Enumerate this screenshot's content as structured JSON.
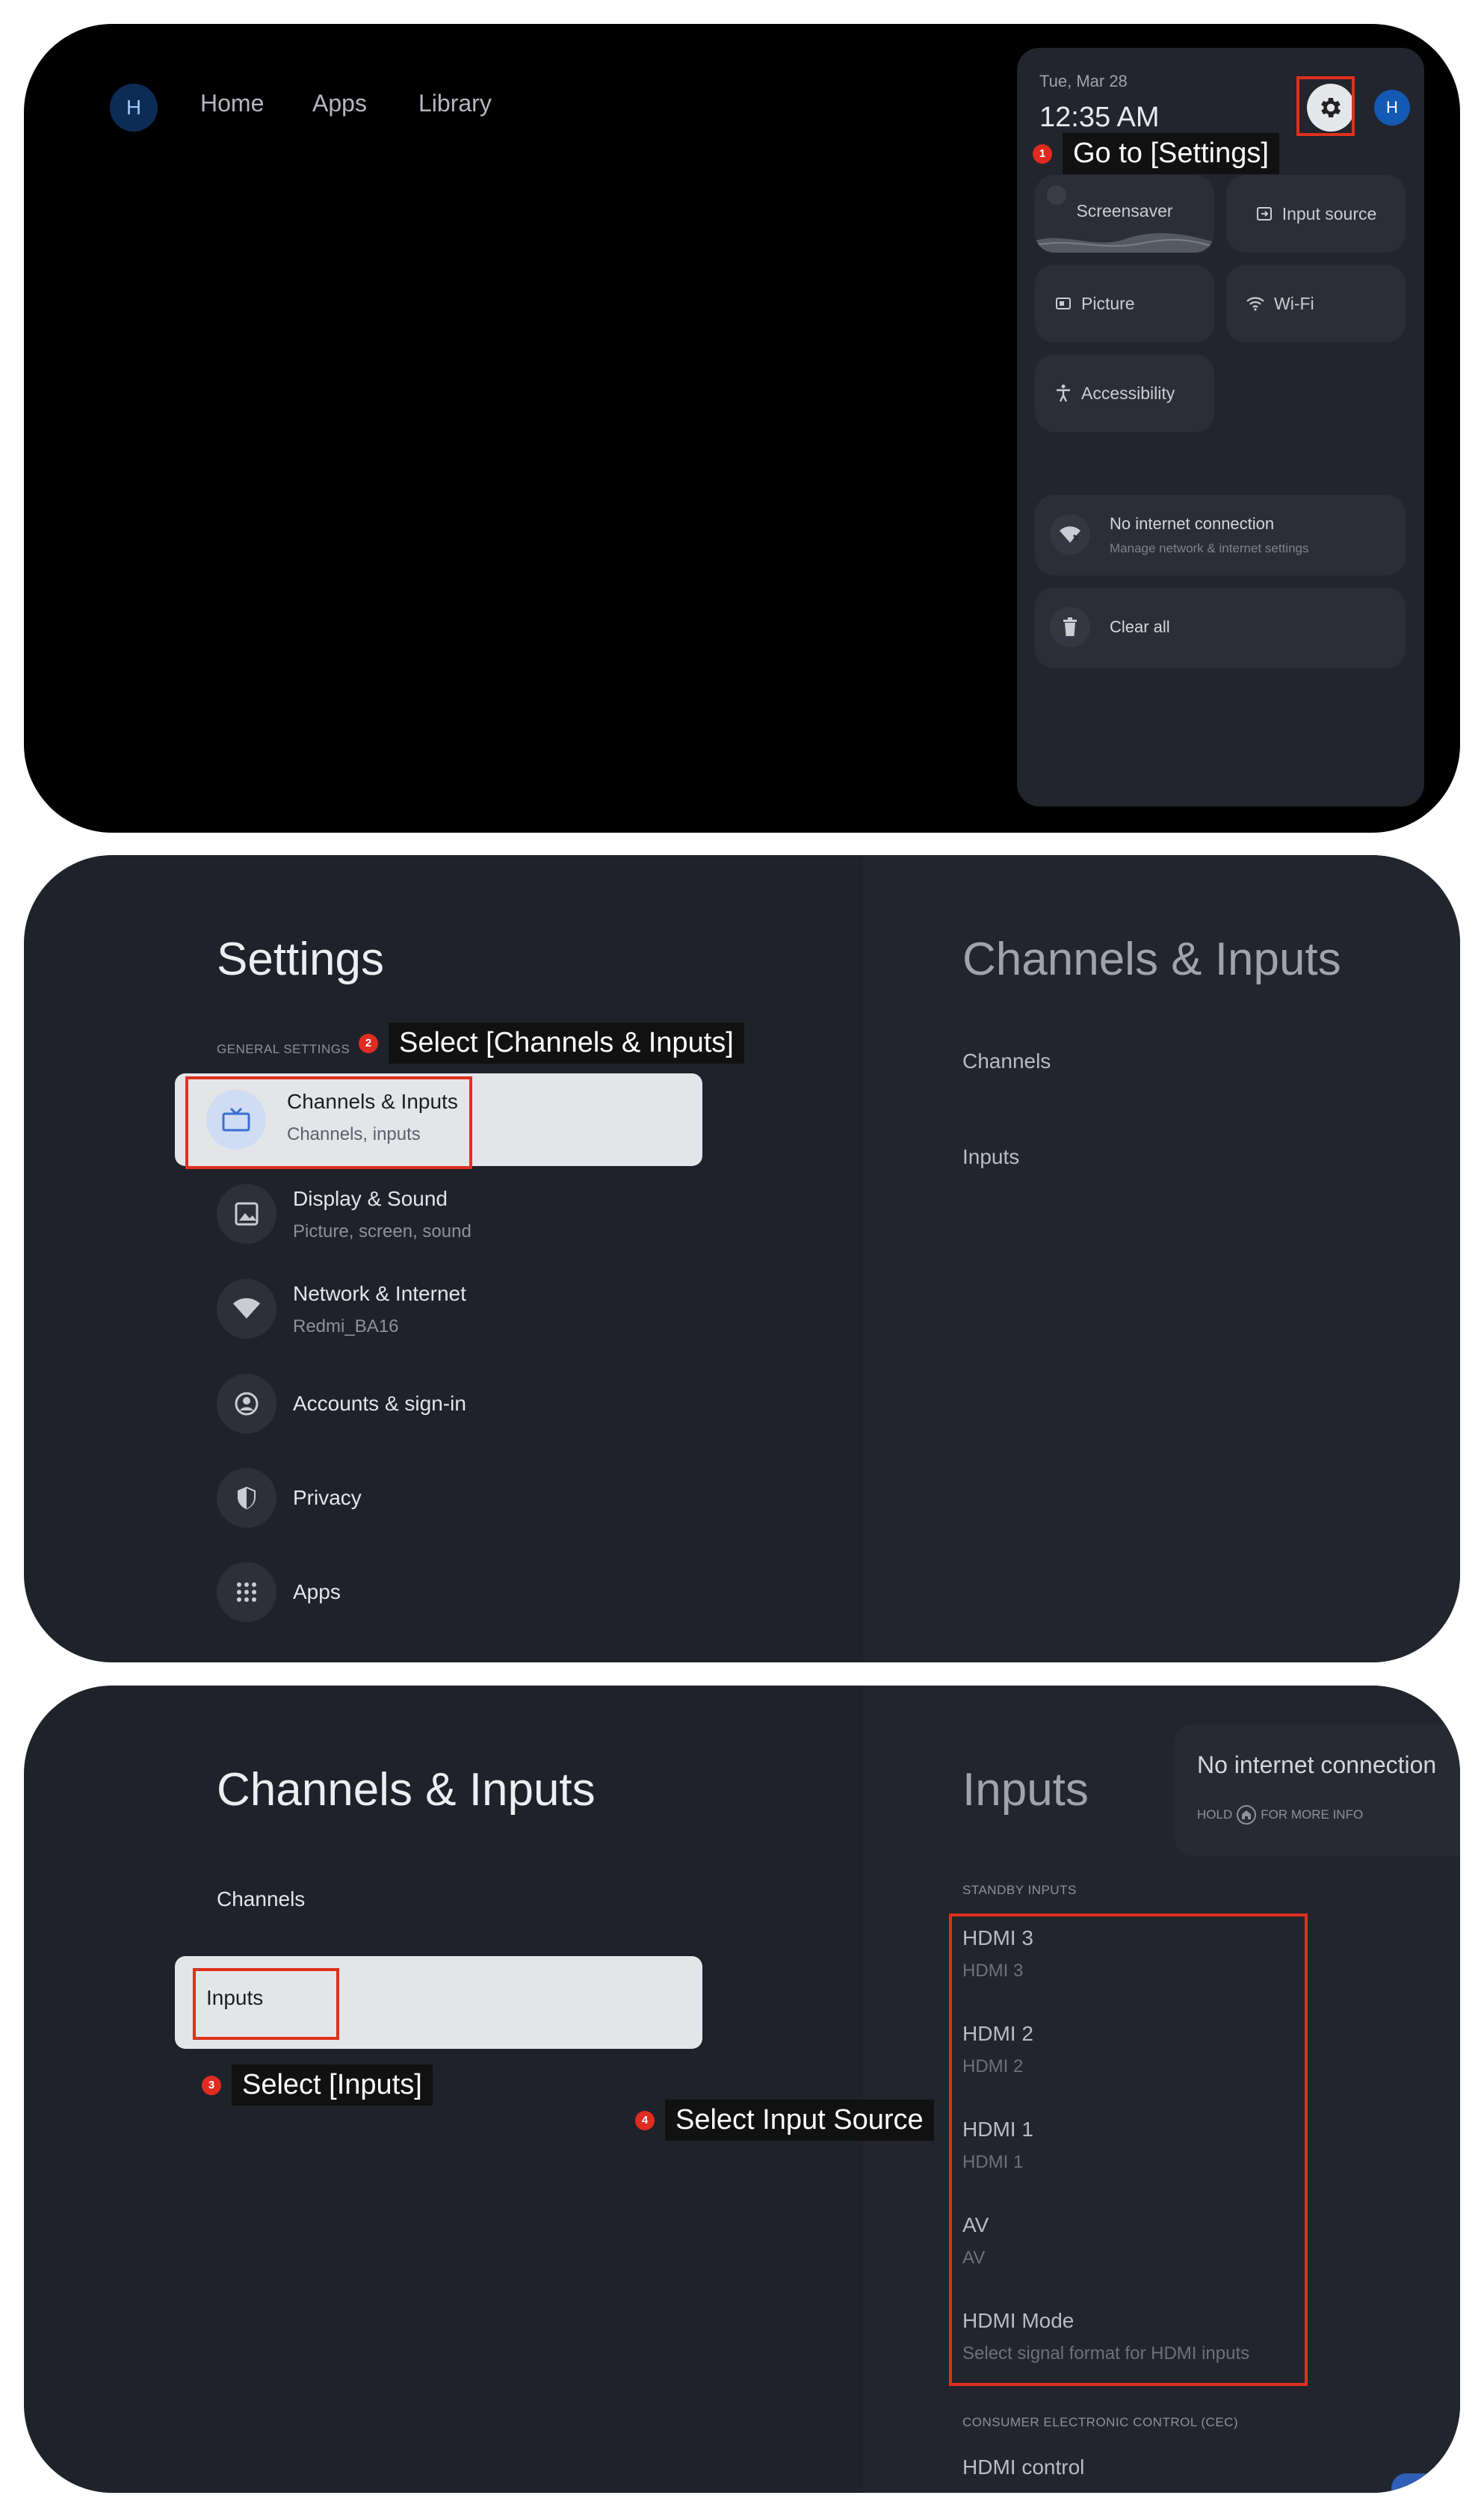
{
  "panel1": {
    "avatar_letter": "H",
    "nav": [
      "Home",
      "Apps",
      "Library"
    ],
    "quick_settings": {
      "date": "Tue, Mar 28",
      "time": "12:35 AM",
      "avatar_letter": "H",
      "tiles": {
        "screensaver": "Screensaver",
        "input_source": "Input source",
        "picture": "Picture",
        "wifi": "Wi-Fi",
        "accessibility": "Accessibility"
      },
      "network": {
        "title": "No internet connection",
        "subtitle": "Manage network & internet settings"
      },
      "clear_all": "Clear all"
    },
    "callout": {
      "number": "1",
      "text": "Go to [Settings]"
    }
  },
  "panel2": {
    "title": "Settings",
    "section_label": "GENERAL SETTINGS",
    "items": [
      {
        "title": "Channels & Inputs",
        "subtitle": "Channels, inputs"
      },
      {
        "title": "Display & Sound",
        "subtitle": "Picture, screen, sound"
      },
      {
        "title": "Network & Internet",
        "subtitle": "Redmi_BA16"
      },
      {
        "title": "Accounts & sign-in",
        "subtitle": ""
      },
      {
        "title": "Privacy",
        "subtitle": ""
      },
      {
        "title": "Apps",
        "subtitle": ""
      }
    ],
    "right": {
      "title": "Channels & Inputs",
      "items": [
        "Channels",
        "Inputs"
      ]
    },
    "callout": {
      "number": "2",
      "text": "Select [Channels & Inputs]"
    }
  },
  "panel3": {
    "title": "Channels & Inputs",
    "items": [
      "Channels",
      "Inputs"
    ],
    "right": {
      "title": "Inputs",
      "standby_label": "STANDBY INPUTS",
      "inputs": [
        {
          "title": "HDMI 3",
          "subtitle": "HDMI 3"
        },
        {
          "title": "HDMI 2",
          "subtitle": "HDMI 2"
        },
        {
          "title": "HDMI 1",
          "subtitle": "HDMI 1"
        },
        {
          "title": "AV",
          "subtitle": "AV"
        },
        {
          "title": "HDMI Mode",
          "subtitle": "Select signal format for HDMI inputs"
        }
      ],
      "cec_label": "CONSUMER ELECTRONIC CONTROL (CEC)",
      "hdmi_control": "HDMI control"
    },
    "toast": {
      "title": "No internet connection",
      "hold": "HOLD",
      "more": "FOR MORE INFO"
    },
    "callout3": {
      "number": "3",
      "text": "Select [Inputs]"
    },
    "callout4": {
      "number": "4",
      "text": "Select Input Source"
    }
  },
  "colors": {
    "panel_bg": "#1f222a",
    "tile_bg": "#2b2e36",
    "selected_card": "#e4e5e9",
    "annotation_red": "#e0301e",
    "avatar_blue": "#1459b3"
  }
}
